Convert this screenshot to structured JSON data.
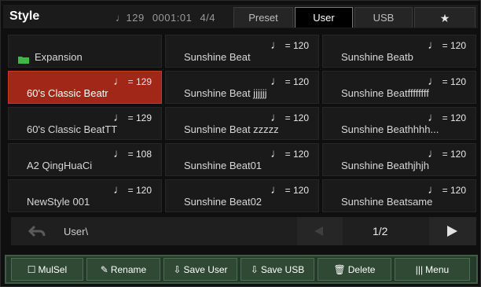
{
  "header": {
    "title": "Style",
    "tempo_note": "♩",
    "tempo": "129",
    "position": "0001:01",
    "time_signature": "4/4",
    "tabs": [
      {
        "label": "Preset",
        "active": false
      },
      {
        "label": "User",
        "active": true
      },
      {
        "label": "USB",
        "active": false
      },
      {
        "label": "★",
        "active": false,
        "icon": "star-icon"
      }
    ]
  },
  "grid": {
    "tempo_prefix": "♩",
    "cells": [
      {
        "name": "Expansion",
        "tempo": "",
        "folder": true,
        "selected": false
      },
      {
        "name": "Sunshine Beat",
        "tempo": "= 120",
        "selected": false
      },
      {
        "name": "Sunshine Beatb",
        "tempo": "= 120",
        "selected": false
      },
      {
        "name": "60's Classic Beatr",
        "tempo": "= 129",
        "selected": true
      },
      {
        "name": "Sunshine Beat jjjjjj",
        "tempo": "= 120",
        "selected": false
      },
      {
        "name": "Sunshine Beatffffffff",
        "tempo": "= 120",
        "selected": false
      },
      {
        "name": "60's Classic BeatTT",
        "tempo": "= 129",
        "selected": false
      },
      {
        "name": "Sunshine Beat zzzzz",
        "tempo": "= 120",
        "selected": false
      },
      {
        "name": "Sunshine Beathhhh...",
        "tempo": "= 120",
        "selected": false
      },
      {
        "name": "A2 QingHuaCi",
        "tempo": "= 108",
        "selected": false
      },
      {
        "name": "Sunshine Beat01",
        "tempo": "= 120",
        "selected": false
      },
      {
        "name": "Sunshine Beathjhjh",
        "tempo": "= 120",
        "selected": false
      },
      {
        "name": "NewStyle 001",
        "tempo": "= 120",
        "selected": false
      },
      {
        "name": "Sunshine Beat02",
        "tempo": "= 120",
        "selected": false
      },
      {
        "name": "Sunshine Beatsame",
        "tempo": "= 120",
        "selected": false
      }
    ]
  },
  "navigation": {
    "path": "User\\",
    "page": "1/2",
    "back_icon": "back-arrow-icon",
    "prev_icon": "prev-page-icon",
    "next_icon": "next-page-icon"
  },
  "actions": [
    {
      "name": "mulsel-button",
      "label": "MulSel",
      "icon": "☐"
    },
    {
      "name": "rename-button",
      "label": "Rename",
      "icon": "✎"
    },
    {
      "name": "save-user-button",
      "label": "Save User",
      "icon": "⇩"
    },
    {
      "name": "save-usb-button",
      "label": "Save USB",
      "icon": "⇩"
    },
    {
      "name": "delete-button",
      "label": "Delete",
      "icon": "🗑"
    },
    {
      "name": "menu-button",
      "label": "Menu",
      "icon": "|||"
    }
  ],
  "colors": {
    "selected": "#a12718",
    "bottom_bar": "#2f4934",
    "folder": "#3fb54a"
  }
}
